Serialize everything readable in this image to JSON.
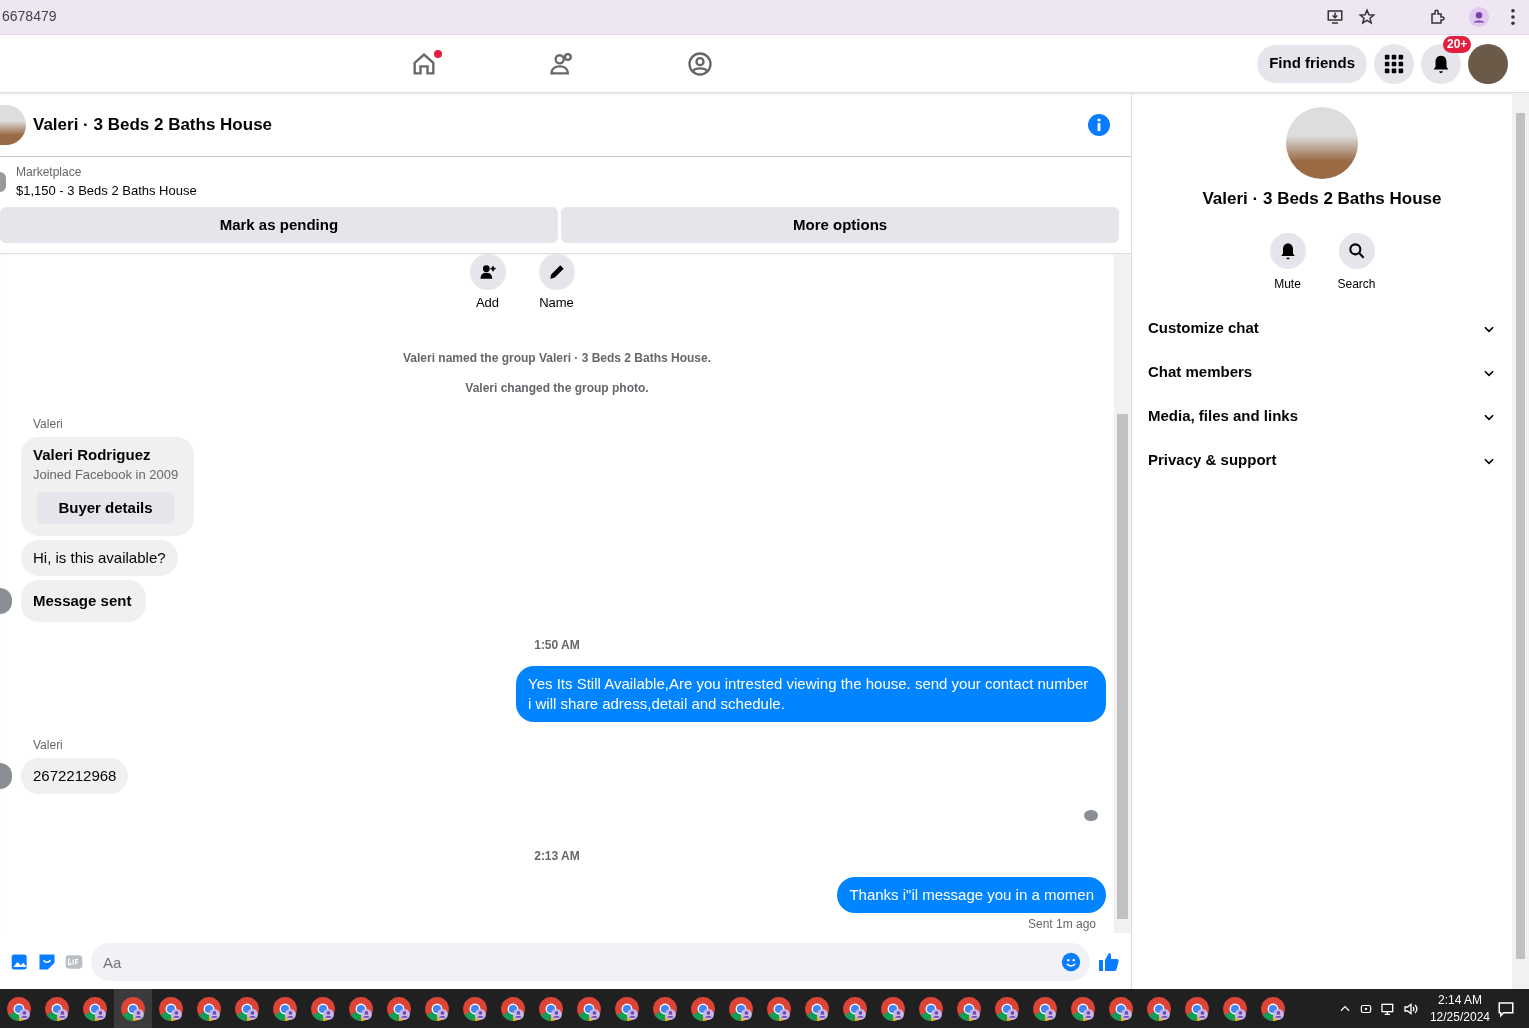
{
  "browser": {
    "url": "6678479"
  },
  "top_nav": {
    "tabs": [
      {
        "notify": true
      },
      {
        "notify": false
      },
      {
        "notify": false
      }
    ],
    "find_friends": "Find friends",
    "notification_count": "20+"
  },
  "chat": {
    "title": "Valeri · 3 Beds 2 Baths House",
    "listing": {
      "source": "Marketplace",
      "item": "$1,150 - 3 Beds 2 Baths House"
    },
    "actions": [
      "Mark as pending",
      "More options"
    ],
    "group_actions": [
      "Add",
      "Name"
    ],
    "messages": [
      {
        "kind": "system",
        "text": "Valeri named the group Valeri · 3 Beds 2 Baths House."
      },
      {
        "kind": "system",
        "text": "Valeri changed the group photo."
      },
      {
        "kind": "sender",
        "text": "Valeri"
      },
      {
        "kind": "card",
        "name": "Valeri Rodriguez",
        "detail": "Joined Facebook in 2009",
        "button": "Buyer details"
      },
      {
        "kind": "incoming",
        "text": "Hi, is this available?",
        "avatar": false,
        "bold": false
      },
      {
        "kind": "incoming",
        "text": "Message sent",
        "avatar": true,
        "bold": true
      },
      {
        "kind": "time",
        "text": "1:50 AM"
      },
      {
        "kind": "outgoing",
        "text": "Yes Its Still Available,Are you intrested viewing the house. send your contact number i will share adress,detail and schedule."
      },
      {
        "kind": "sender",
        "text": "Valeri"
      },
      {
        "kind": "incoming",
        "text": "2672212968",
        "avatar": true,
        "bold": false
      },
      {
        "kind": "seen"
      },
      {
        "kind": "time",
        "text": "2:13 AM"
      },
      {
        "kind": "outgoing",
        "text": "Thanks i\"il message you in a momen"
      },
      {
        "kind": "status",
        "text": "Sent 1m ago"
      }
    ],
    "composer": {
      "placeholder": "Aa"
    }
  },
  "details": {
    "title": "Valeri · 3 Beds 2 Baths House",
    "buttons": [
      "Mute",
      "Search"
    ],
    "sections": [
      {
        "label": "Customize chat",
        "expanded": false
      },
      {
        "label": "Chat members",
        "expanded": false
      },
      {
        "label": "Media, files and links",
        "expanded": false
      },
      {
        "label": "Privacy & support",
        "expanded": false
      }
    ]
  },
  "taskbar": {
    "apps": [
      {
        "selected": false
      },
      {
        "selected": false
      },
      {
        "selected": false
      },
      {
        "selected": true
      },
      {
        "selected": false
      },
      {
        "selected": false
      },
      {
        "selected": false
      },
      {
        "selected": false
      },
      {
        "selected": false
      },
      {
        "selected": false
      },
      {
        "selected": false
      },
      {
        "selected": false
      },
      {
        "selected": false
      },
      {
        "selected": false
      },
      {
        "selected": false
      },
      {
        "selected": false
      },
      {
        "selected": false
      },
      {
        "selected": false
      },
      {
        "selected": false
      },
      {
        "selected": false
      },
      {
        "selected": false
      },
      {
        "selected": false
      },
      {
        "selected": false
      },
      {
        "selected": false
      },
      {
        "selected": false
      },
      {
        "selected": false
      },
      {
        "selected": false
      },
      {
        "selected": false
      },
      {
        "selected": false
      },
      {
        "selected": false
      },
      {
        "selected": false
      },
      {
        "selected": false
      },
      {
        "selected": false
      },
      {
        "selected": false
      }
    ],
    "time": "2:14 AM",
    "date": "12/25/2024"
  }
}
